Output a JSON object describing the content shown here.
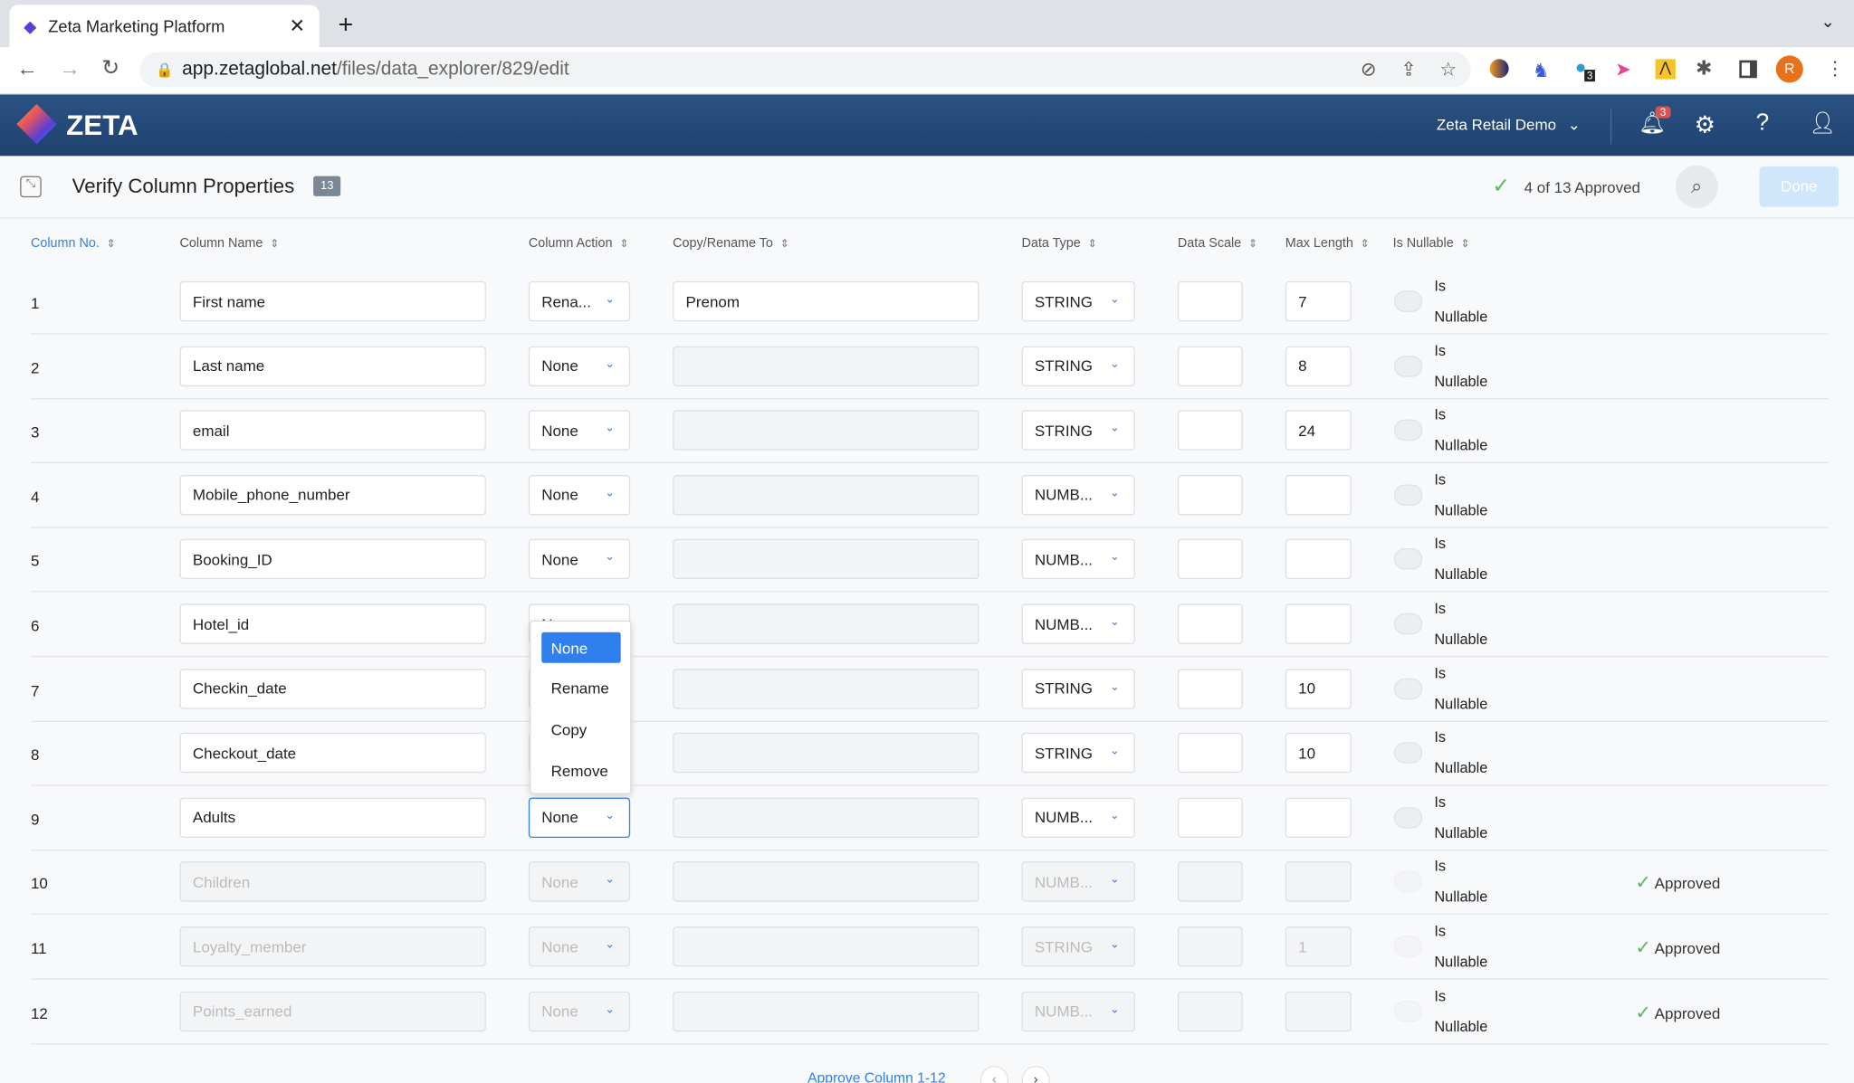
{
  "browser": {
    "tab_title": "Zeta Marketing Platform",
    "url_host": "app.zetaglobal.net",
    "url_path": "/files/data_explorer/829/edit",
    "extension_badge": "3",
    "profile_initial": "R"
  },
  "nav": {
    "logo": "ZETA",
    "account": "Zeta Retail Demo",
    "notification_count": "3"
  },
  "page": {
    "title": "Verify Column Properties",
    "count": "13",
    "approved_status": "4 of 13 Approved",
    "done_label": "Done"
  },
  "headers": [
    "Column No.",
    "Column Name",
    "Column Action",
    "Copy/Rename To",
    "Data Type",
    "Data Scale",
    "Max Length",
    "Is Nullable"
  ],
  "rows": [
    {
      "no": "1",
      "name": "First name",
      "action": "Rena...",
      "rename": "Prenom",
      "type": "STRING",
      "scale": "",
      "max": "7",
      "approved": false
    },
    {
      "no": "2",
      "name": "Last name",
      "action": "None",
      "rename": "",
      "type": "STRING",
      "scale": "",
      "max": "8",
      "approved": false
    },
    {
      "no": "3",
      "name": "email",
      "action": "None",
      "rename": "",
      "type": "STRING",
      "scale": "",
      "max": "24",
      "approved": false
    },
    {
      "no": "4",
      "name": "Mobile_phone_number",
      "action": "None",
      "rename": "",
      "type": "NUMB...",
      "scale": "",
      "max": "",
      "approved": false
    },
    {
      "no": "5",
      "name": "Booking_ID",
      "action": "None",
      "rename": "",
      "type": "NUMB...",
      "scale": "",
      "max": "",
      "approved": false
    },
    {
      "no": "6",
      "name": "Hotel_id",
      "action": "None",
      "rename": "",
      "type": "NUMB...",
      "scale": "",
      "max": "",
      "approved": false
    },
    {
      "no": "7",
      "name": "Checkin_date",
      "action": "None",
      "rename": "",
      "type": "STRING",
      "scale": "",
      "max": "10",
      "approved": false
    },
    {
      "no": "8",
      "name": "Checkout_date",
      "action": "None",
      "rename": "",
      "type": "STRING",
      "scale": "",
      "max": "10",
      "approved": false
    },
    {
      "no": "9",
      "name": "Adults",
      "action": "None",
      "rename": "",
      "type": "NUMB...",
      "scale": "",
      "max": "",
      "approved": false
    },
    {
      "no": "10",
      "name": "Children",
      "action": "None",
      "rename": "",
      "type": "NUMB...",
      "scale": "",
      "max": "",
      "approved": true
    },
    {
      "no": "11",
      "name": "Loyalty_member",
      "action": "None",
      "rename": "",
      "type": "STRING",
      "scale": "",
      "max": "1",
      "approved": true
    },
    {
      "no": "12",
      "name": "Points_earned",
      "action": "None",
      "rename": "",
      "type": "NUMB...",
      "scale": "",
      "max": "",
      "approved": true
    }
  ],
  "nullable": {
    "line1": "Is",
    "line2": "Nullable"
  },
  "approved_label": "Approved",
  "action_menu": {
    "options": [
      "None",
      "Rename",
      "Copy",
      "Remove"
    ],
    "selected": "None"
  },
  "footer": {
    "approve_label": "Approve Column 1-12"
  },
  "colors": {
    "nav": "#234a78",
    "accent": "#2f80ed",
    "approved_green": "#5cb85c",
    "done_disabled": "#cfe6fb"
  }
}
